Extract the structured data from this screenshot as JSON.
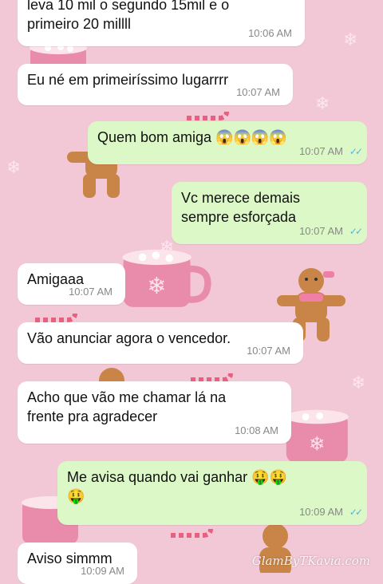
{
  "chat": {
    "messages": [
      {
        "direction": "incoming",
        "text": "leva 10 mil o segundo 15mil e  o\nprimeiro 20 millll",
        "time": "10:06 AM"
      },
      {
        "direction": "incoming",
        "text": "Eu né em primeiríssimo lugarrrr",
        "time": "10:07 AM"
      },
      {
        "direction": "outgoing",
        "text": "Quem bom amiga 😱😱😱😱",
        "time": "10:07 AM",
        "status": "read"
      },
      {
        "direction": "outgoing",
        "text": "Vc merece demais\nsempre esforçada",
        "time": "10:07 AM",
        "status": "read"
      },
      {
        "direction": "incoming",
        "text": "Amigaaa",
        "time": "10:07 AM"
      },
      {
        "direction": "incoming",
        "text": "Vão anunciar agora o vencedor.",
        "time": "10:07 AM"
      },
      {
        "direction": "incoming",
        "text": "Acho que vão me chamar lá na\nfrente pra agradecer",
        "time": "10:08 AM"
      },
      {
        "direction": "outgoing",
        "text": "Me avisa quando vai ganhar 🤑🤑\n🤑",
        "time": "10:09 AM",
        "status": "read"
      },
      {
        "direction": "incoming",
        "text": "Aviso simmm",
        "time": "10:09 AM"
      }
    ],
    "read_tick_icon": "double-check-icon",
    "watermark": "GlamByTKavia.com"
  },
  "colors": {
    "wallpaper": "#f3c8d6",
    "incoming_bubble": "#ffffff",
    "outgoing_bubble": "#dcf8c6",
    "read_ticks": "#4fb6ec"
  }
}
